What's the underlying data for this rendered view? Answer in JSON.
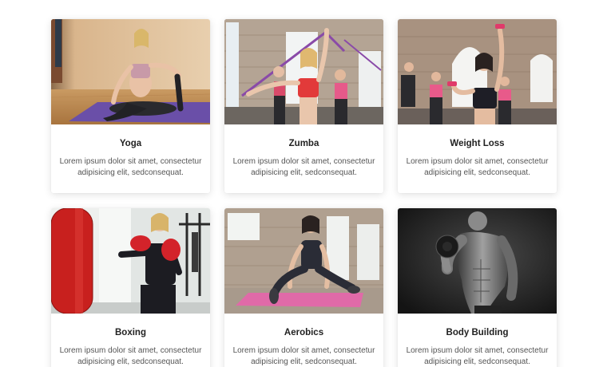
{
  "cards": [
    {
      "title": "Yoga",
      "description": "Lorem ipsum dolor sit amet, consectetur adipisicing elit, sedconsequat.",
      "image": "woman-yoga-pose-photo"
    },
    {
      "title": "Zumba",
      "description": "Lorem ipsum dolor sit amet, consectetur adipisicing elit, sedconsequat.",
      "image": "women-resistance-band-class-photo"
    },
    {
      "title": "Weight Loss",
      "description": "Lorem ipsum dolor sit amet, consectetur adipisicing elit, sedconsequat.",
      "image": "women-dumbbell-class-photo"
    },
    {
      "title": "Boxing",
      "description": "Lorem ipsum dolor sit amet, consectetur adipisicing elit, sedconsequat.",
      "image": "woman-boxing-gloves-photo"
    },
    {
      "title": "Aerobics",
      "description": "Lorem ipsum dolor sit amet, consectetur adipisicing elit, sedconsequat.",
      "image": "woman-stretching-mat-photo"
    },
    {
      "title": "Body Building",
      "description": "Lorem ipsum dolor sit amet, consectetur adipisicing elit, sedconsequat.",
      "image": "man-dumbbell-curl-photo"
    }
  ],
  "colors": {
    "card_background": "#ffffff",
    "title_text": "#222222",
    "description_text": "#555555",
    "yoga_mat": "#6a4fa8",
    "aerobics_mat": "#e06aa8",
    "boxing_gloves": "#d3232a"
  }
}
